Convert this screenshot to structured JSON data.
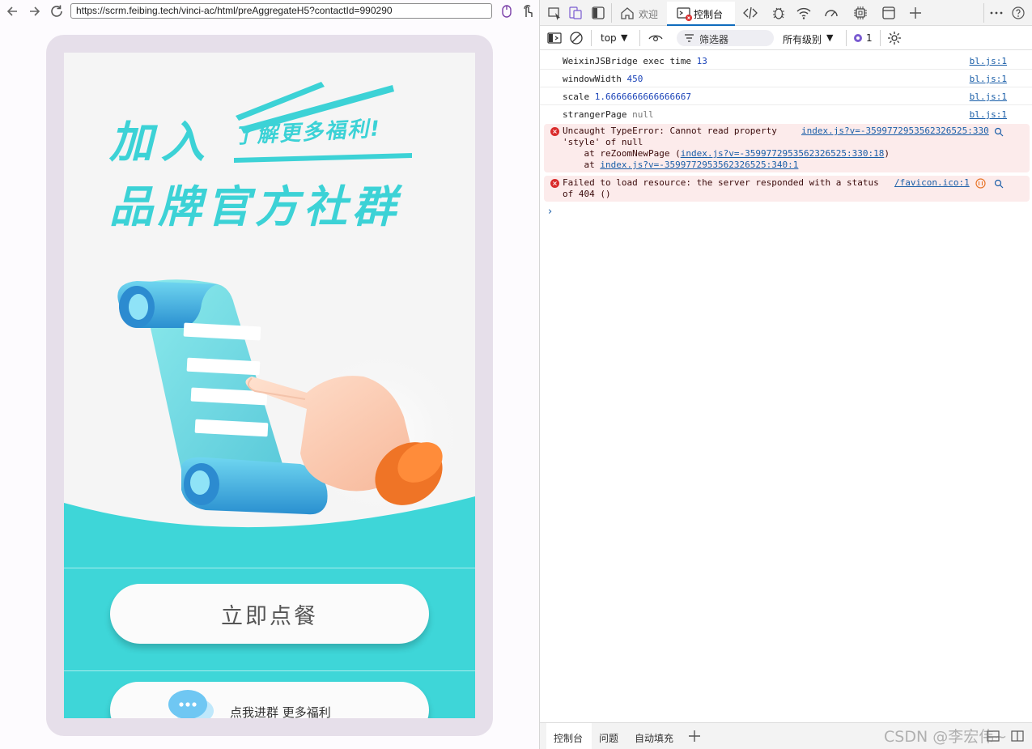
{
  "browser": {
    "url": "https://scrm.feibing.tech/vinci-ac/html/preAggregateH5?contactId=990290"
  },
  "page": {
    "banner_line1": "加入",
    "banner_tagline": "了解更多福利!",
    "banner_line2": "品牌官方社群",
    "order_button": "立即点餐",
    "group_button": "点我进群 更多福利",
    "colors": {
      "teal": "#3ed6d8",
      "banner_text": "#3cd2d6",
      "frame": "#e6dfea",
      "sleeve": "#f47a2a"
    }
  },
  "devtools": {
    "tabs": {
      "welcome": "欢迎",
      "console": "控制台"
    },
    "toolbar": {
      "context": "top",
      "filter_placeholder": "筛选器",
      "levels": "所有级别",
      "issue_count": "1"
    },
    "logs": [
      {
        "key": "WeixinJSBridge exec time",
        "value": "13",
        "source": "bl.js:1"
      },
      {
        "key": "windowWidth",
        "value": "450",
        "source": "bl.js:1"
      },
      {
        "key": "scale",
        "value": "1.6666666666666667",
        "source": "bl.js:1"
      },
      {
        "key": "strangerPage",
        "value": "null",
        "source": "bl.js:1"
      }
    ],
    "error1": {
      "line1": "Uncaught TypeError: Cannot read property",
      "line2": "'style' of null",
      "line3_prefix": "    at reZoomNewPage (",
      "line3_link": "index.js?v=-3599772953562326525:330:18",
      "line3_suffix": ")",
      "line4_prefix": "    at ",
      "line4_link": "index.js?v=-3599772953562326525:340:1",
      "source": "index.js?v=-3599772953562326525:330"
    },
    "error2": {
      "line1": "Failed to load resource: the server responded with a status",
      "line2": "of 404 ()",
      "source": "/favicon.ico:1"
    },
    "bottom_tabs": {
      "console": "控制台",
      "issues": "问题",
      "autofill": "自动填充"
    },
    "watermark": "CSDN @李宏伟~"
  }
}
